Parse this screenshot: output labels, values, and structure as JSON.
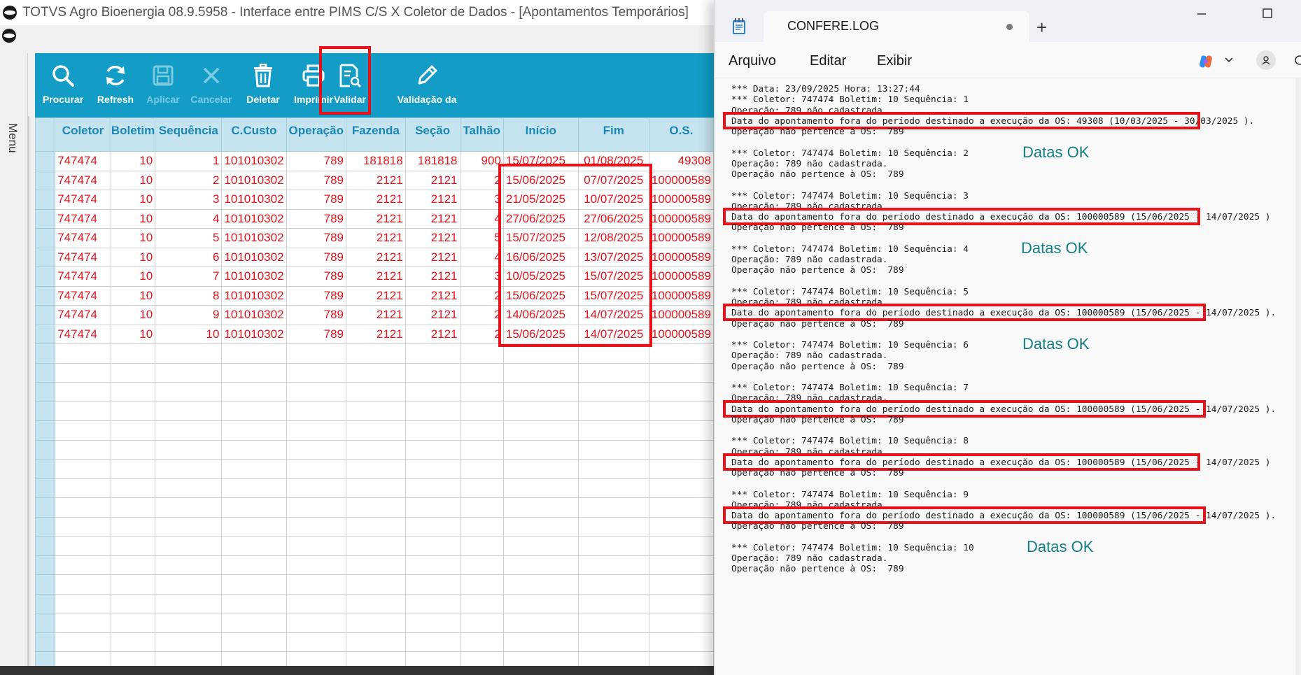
{
  "left_app": {
    "title": "TOTVS Agro Bioenergia 08.9.5958 - Interface entre PIMS C/S X Coletor de Dados - [Apontamentos Temporários]",
    "menu_label": "Menu",
    "toolbar": {
      "procurar": "Procurar",
      "refresh": "Refresh",
      "aplicar": "Aplicar",
      "cancelar": "Cancelar",
      "deletar": "Deletar",
      "imprimir": "Imprimir",
      "validar": "Validar",
      "validacao": "Validação da"
    },
    "columns": [
      "Coletor",
      "Boletim",
      "Sequência",
      "C.Custo",
      "Operação",
      "Fazenda",
      "Seção",
      "Talhão",
      "Início",
      "Fim",
      "O.S."
    ],
    "rows": [
      [
        "747474",
        "10",
        "1",
        "101010302",
        "789",
        "181818",
        "181818",
        "900",
        "15/07/2025",
        "01/08/2025",
        "49308"
      ],
      [
        "747474",
        "10",
        "2",
        "101010302",
        "789",
        "2121",
        "2121",
        "2",
        "15/06/2025",
        "07/07/2025",
        "100000589"
      ],
      [
        "747474",
        "10",
        "3",
        "101010302",
        "789",
        "2121",
        "2121",
        "3",
        "21/05/2025",
        "10/07/2025",
        "100000589"
      ],
      [
        "747474",
        "10",
        "4",
        "101010302",
        "789",
        "2121",
        "2121",
        "4",
        "27/06/2025",
        "27/06/2025",
        "100000589"
      ],
      [
        "747474",
        "10",
        "5",
        "101010302",
        "789",
        "2121",
        "2121",
        "5",
        "15/07/2025",
        "12/08/2025",
        "100000589"
      ],
      [
        "747474",
        "10",
        "6",
        "101010302",
        "789",
        "2121",
        "2121",
        "4",
        "16/06/2025",
        "13/07/2025",
        "100000589"
      ],
      [
        "747474",
        "10",
        "7",
        "101010302",
        "789",
        "2121",
        "2121",
        "3",
        "10/05/2025",
        "15/07/2025",
        "100000589"
      ],
      [
        "747474",
        "10",
        "8",
        "101010302",
        "789",
        "2121",
        "2121",
        "2",
        "15/06/2025",
        "15/07/2025",
        "100000589"
      ],
      [
        "747474",
        "10",
        "9",
        "101010302",
        "789",
        "2121",
        "2121",
        "2",
        "14/06/2025",
        "14/07/2025",
        "100000589"
      ],
      [
        "747474",
        "10",
        "10",
        "101010302",
        "789",
        "2121",
        "2121",
        "2",
        "15/06/2025",
        "14/07/2025",
        "100000589"
      ]
    ],
    "colors": {
      "toolbar": "#139dc6",
      "header_bg": "#c6e4f0",
      "header_text": "#1a87b5",
      "row_text": "#e8131a",
      "highlight": "#e8131a"
    }
  },
  "notepad": {
    "tab_title": "CONFERE.LOG",
    "new_tab": "+",
    "menu": {
      "arquivo": "Arquivo",
      "editar": "Editar",
      "exibir": "Exibir"
    },
    "lines": [
      "*** Data: 23/09/2025 Hora: 13:27:44",
      "*** Coletor: 747474 Boletim: 10 Sequência: 1",
      "Operação: 789 não cadastrada.",
      "Data do apontamento fora do período destinado a execução da OS: 49308 (10/03/2025 - 30/03/2025 ).",
      "Operação não pertence à OS:  789",
      "",
      "*** Coletor: 747474 Boletim: 10 Sequência: 2",
      "Operação: 789 não cadastrada.",
      "Operação não pertence à OS:  789",
      "",
      "*** Coletor: 747474 Boletim: 10 Sequência: 3",
      "Operação: 789 não cadastrada.",
      "Data do apontamento fora do período destinado a execução da OS: 100000589 (15/06/2025 - 14/07/2025 )",
      "Operação não pertence à OS:  789",
      "",
      "*** Coletor: 747474 Boletim: 10 Sequência: 4",
      "Operação: 789 não cadastrada.",
      "Operação não pertence à OS:  789",
      "",
      "*** Coletor: 747474 Boletim: 10 Sequência: 5",
      "Operação: 789 não cadastrada.",
      "Data do apontamento fora do período destinado a execução da OS: 100000589 (15/06/2025 - 14/07/2025 ).",
      "Operação não pertence à OS:  789",
      "",
      "*** Coletor: 747474 Boletim: 10 Sequência: 6",
      "Operação: 789 não cadastrada.",
      "Operação não pertence à OS:  789",
      "",
      "*** Coletor: 747474 Boletim: 10 Sequência: 7",
      "Operação: 789 não cadastrada.",
      "Data do apontamento fora do período destinado a execução da OS: 100000589 (15/06/2025 - 14/07/2025 ).",
      "Operação não pertence à OS:  789",
      "",
      "*** Coletor: 747474 Boletim: 10 Sequência: 8",
      "Operação: 789 não cadastrada.",
      "Data do apontamento fora do período destinado a execução da OS: 100000589 (15/06/2025 - 14/07/2025 )",
      "Operação não pertence à OS:  789",
      "",
      "*** Coletor: 747474 Boletim: 10 Sequência: 9",
      "Operação: 789 não cadastrada.",
      "Data do apontamento fora do período destinado a execução da OS: 100000589 (15/06/2025 - 14/07/2025 ).",
      "Operação não pertence à OS:  789",
      "",
      "*** Coletor: 747474 Boletim: 10 Sequência: 10",
      "Operação: 789 não cadastrada.",
      "Operação não pertence à OS:  789"
    ],
    "annotations": {
      "ok_seq2": "Datas OK",
      "ok_seq4": "Datas OK",
      "ok_seq6": "Datas OK",
      "ok_seq10": "Datas OK"
    },
    "ok_color": "#137e86"
  }
}
